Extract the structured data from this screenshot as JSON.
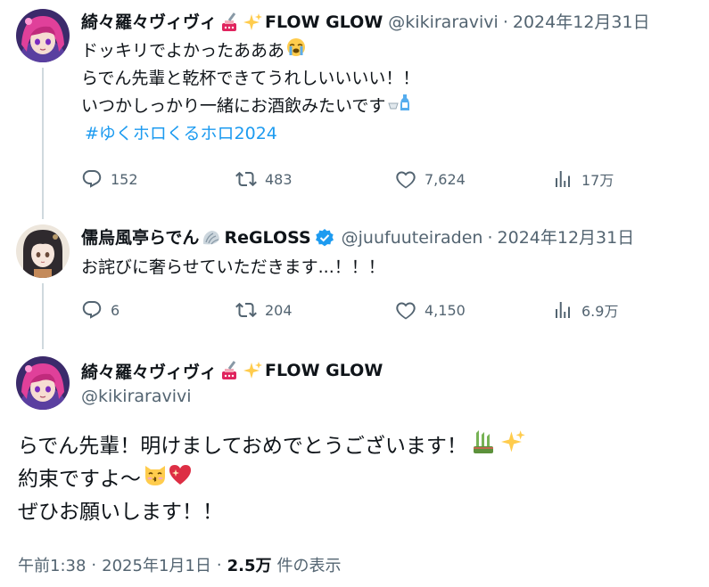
{
  "colors": {
    "text": "#0f1419",
    "muted": "#536471",
    "link": "#1d9bf0",
    "thread": "#cfd9de",
    "verified": "#1d9bf0"
  },
  "tweet1": {
    "author_name": "綺々羅々ヴィヴィ",
    "author_suffix": "FLOW GLOW",
    "handle": "@kikiraravivi",
    "separator": "·",
    "date": "2024年12月31日",
    "lines": [
      "ドッキリでよかったあああ",
      "らでん先輩と乾杯できてうれしいいいい！！",
      "いつかしっかり一緒にお酒飲みたいです"
    ],
    "hashtag": "#ゆくホロくるホロ2024",
    "replies": "152",
    "reposts": "483",
    "likes": "7,624",
    "views": "17万"
  },
  "tweet2": {
    "author_name": "儒烏風亭らでん",
    "author_suffix": "ReGLOSS",
    "handle": "@juufuuteiraden",
    "separator": "·",
    "date": "2024年12月31日",
    "text": "お詫びに奢らせていただきます...！！！",
    "replies": "6",
    "reposts": "204",
    "likes": "4,150",
    "views": "6.9万"
  },
  "main": {
    "author_name": "綺々羅々ヴィヴィ",
    "author_suffix": "FLOW GLOW",
    "handle": "@kikiraravivi",
    "lines": [
      "らでん先輩！明けましておめでとうございます！",
      "約束ですよ〜",
      "ぜひお願いします！！"
    ],
    "time": "午前1:38",
    "separator": "·",
    "date": "2025年1月1日",
    "views_count": "2.5万",
    "views_label": "件の表示"
  },
  "icons": [
    "avatar-vivi",
    "avatar-raden",
    "nail-polish-icon",
    "sparkles-icon",
    "shell-icon",
    "verified-badge-icon",
    "crying-face-icon",
    "sake-icon",
    "kadomatsu-icon",
    "kissing-cat-icon",
    "sparkling-heart-icon",
    "reply-icon",
    "repost-icon",
    "like-icon",
    "views-icon"
  ]
}
